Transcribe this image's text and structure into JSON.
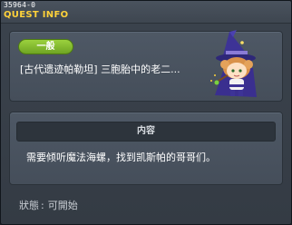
{
  "window": {
    "quest_id": "35964-0",
    "title": "QUEST INFO"
  },
  "quest": {
    "category": "一般",
    "title": "[古代遗迹帕勒坦] 三胞胎中的老二...",
    "character_icon": "witch-hat-character-icon"
  },
  "content": {
    "header": "内容",
    "description": "需要倾听魔法海螺，找到凯斯帕的哥哥们。"
  },
  "status": {
    "label": "狀態",
    "value": "可開始"
  },
  "colors": {
    "title": "#ffd23a",
    "badge": "#8cc63f",
    "background": "#3b434d",
    "panel": "#4e5865"
  }
}
